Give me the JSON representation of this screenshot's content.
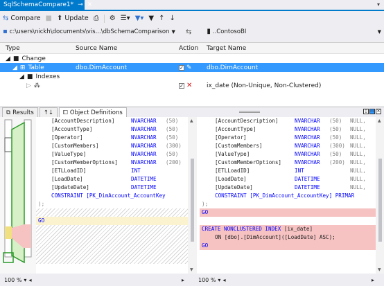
{
  "tab": {
    "title": "SqlSchemaCompare1*",
    "pin": "⊸",
    "close": "✕"
  },
  "toolbar": {
    "compare_label": "Compare",
    "update_label": "Update"
  },
  "pathbar": {
    "source_path": "c:\\users\\nickh\\documents\\vis...\\dbSchemaComparison",
    "target": "..ContosoBI"
  },
  "grid": {
    "headers": {
      "type": "Type",
      "source": "Source Name",
      "action": "Action",
      "target": "Target Name"
    },
    "rows": [
      {
        "indent": 0,
        "label": "Change",
        "source": "",
        "target": ""
      },
      {
        "indent": 1,
        "label": "Table",
        "source": "dbo.DimAccount",
        "target": "dbo.DimAccount"
      },
      {
        "indent": 2,
        "label": "Indexes",
        "source": "",
        "target": ""
      },
      {
        "indent": 3,
        "label": "",
        "source": "",
        "target": "ix_date (Non-Unique, Non-Clustered)"
      }
    ]
  },
  "lower_tabs": {
    "results": "Results",
    "sort": "↑↓",
    "object_definitions": "Object Definitions"
  },
  "left_code": [
    {
      "name": "[AccountDescription]",
      "type": "NVARCHAR",
      "size": "(50)"
    },
    {
      "name": "[AccountType]",
      "type": "NVARCHAR",
      "size": "(50)"
    },
    {
      "name": "[Operator]",
      "type": "NVARCHAR",
      "size": "(50)"
    },
    {
      "name": "[CustomMembers]",
      "type": "NVARCHAR",
      "size": "(300)"
    },
    {
      "name": "[ValueType]",
      "type": "NVARCHAR",
      "size": "(50)"
    },
    {
      "name": "[CustomMemberOptions]",
      "type": "NVARCHAR",
      "size": "(200)"
    },
    {
      "name": "[ETLLoadID]",
      "type": "INT",
      "size": ""
    },
    {
      "name": "[LoadDate]",
      "type": "DATETIME",
      "size": ""
    },
    {
      "name": "[UpdateDate]",
      "type": "DATETIME",
      "size": ""
    }
  ],
  "left_constraint": "CONSTRAINT [PK_DimAccount_AccountKey",
  "right_code": [
    {
      "name": "[AccountDescription]",
      "type": "NVARCHAR",
      "size": "(50)",
      "null": "NULL,"
    },
    {
      "name": "[AccountType]",
      "type": "NVARCHAR",
      "size": "(50)",
      "null": "NULL,"
    },
    {
      "name": "[Operator]",
      "type": "NVARCHAR",
      "size": "(50)",
      "null": "NULL,"
    },
    {
      "name": "[CustomMembers]",
      "type": "NVARCHAR",
      "size": "(300)",
      "null": "NULL,"
    },
    {
      "name": "[ValueType]",
      "type": "NVARCHAR",
      "size": "(50)",
      "null": "NULL,"
    },
    {
      "name": "[CustomMemberOptions]",
      "type": "NVARCHAR",
      "size": "(200)",
      "null": "NULL,"
    },
    {
      "name": "[ETLLoadID]",
      "type": "INT",
      "size": "",
      "null": "NULL,"
    },
    {
      "name": "[LoadDate]",
      "type": "DATETIME",
      "size": "",
      "null": "NULL,"
    },
    {
      "name": "[UpdateDate]",
      "type": "DATETIME",
      "size": "",
      "null": "NULL,"
    }
  ],
  "right_constraint": "CONSTRAINT [PK_DimAccount_AccountKey] PRIMAR",
  "code_tokens": {
    "close_paren": ");",
    "go": "GO",
    "create_index": "CREATE NONCLUSTERED INDEX",
    "index_name": "[ix_date]",
    "on_clause": "ON [dbo].[DimAccount]([LoadDate] ASC);"
  },
  "status": {
    "left_zoom": "100 %",
    "right_zoom": "100 %"
  },
  "colors": {
    "accent": "#007acc",
    "selection": "#3399ff",
    "diff_pink": "#f6c2c2",
    "keyword": "#0000ff"
  }
}
